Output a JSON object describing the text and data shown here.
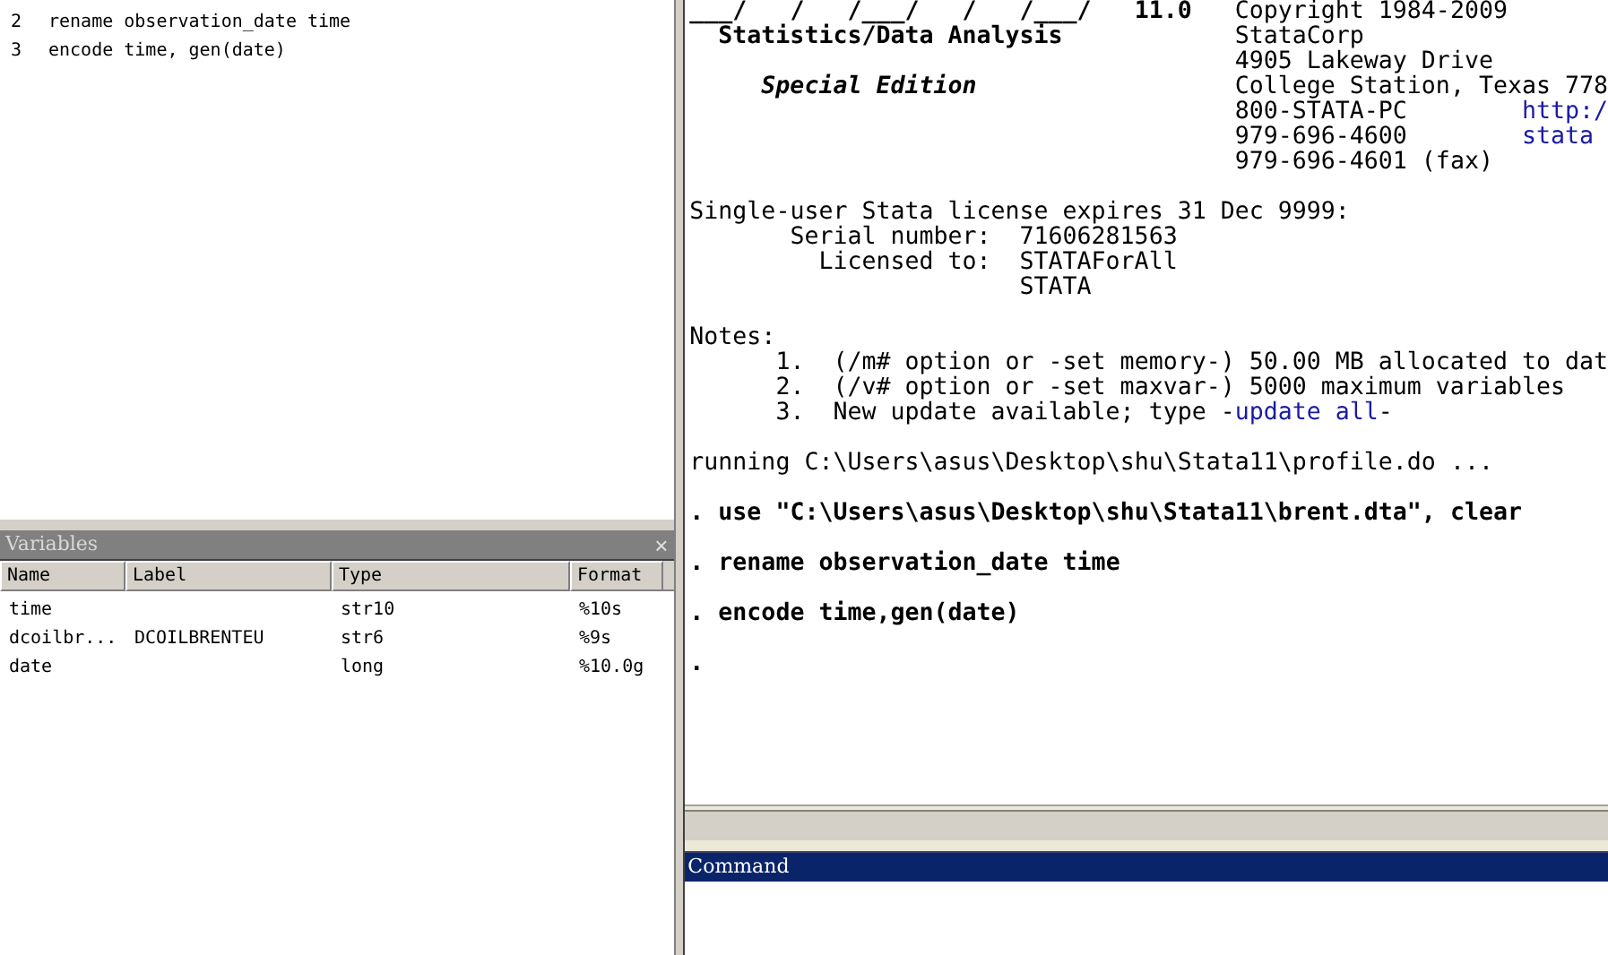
{
  "review": {
    "items": [
      {
        "number": "2",
        "command": "rename observation_date time"
      },
      {
        "number": "3",
        "command": "encode time, gen(date)"
      }
    ]
  },
  "variables": {
    "title": "Variables",
    "close": "×",
    "columns": [
      "Name",
      "Label",
      "Type",
      "Format"
    ],
    "rows": [
      [
        "time",
        "",
        "str10",
        "%10s"
      ],
      [
        "dcoilbr...",
        "DCOILBRENTEU",
        "str6",
        "%9s"
      ],
      [
        "date",
        "",
        "long",
        "%10.0g"
      ]
    ]
  },
  "results": {
    "banner": {
      "logo": "___/   /   /___/   /   /___/",
      "version": "11.0",
      "product": "Statistics/Data Analysis",
      "edition": "Special Edition",
      "contact": [
        "Copyright 1984-2009",
        "StataCorp",
        "4905 Lakeway Drive",
        "College Station, Texas 778",
        "800-STATA-PC",
        "979-696-4600",
        "979-696-4601 (fax)"
      ],
      "links": [
        "http:/",
        "stata"
      ]
    },
    "license": {
      "heading": "Single-user Stata license expires 31 Dec 9999:",
      "fields": [
        {
          "label": "Serial number:",
          "values": [
            "71606281563"
          ]
        },
        {
          "label": "Licensed to:",
          "values": [
            "STATAForAll",
            "STATA"
          ]
        }
      ]
    },
    "notes": {
      "heading": "Notes:",
      "items": [
        {
          "number": "1.",
          "text": "(/m# option or -set memory-) 50.00 MB allocated to dat"
        },
        {
          "number": "2.",
          "text": "(/v# option or -set maxvar-) 5000 maximum variables"
        },
        {
          "number": "3.",
          "text": "New update available; type -",
          "link": "update all",
          "suffix": "-"
        }
      ]
    },
    "running": "running C:\\Users\\asus\\Desktop\\shu\\Stata11\\profile.do ...",
    "commands": [
      ". use \"C:\\Users\\asus\\Desktop\\shu\\Stata11\\brent.dta\", clear",
      ". rename observation_date time",
      ". encode time,gen(date)"
    ],
    "prompt": "."
  },
  "command": {
    "title": "Command"
  }
}
